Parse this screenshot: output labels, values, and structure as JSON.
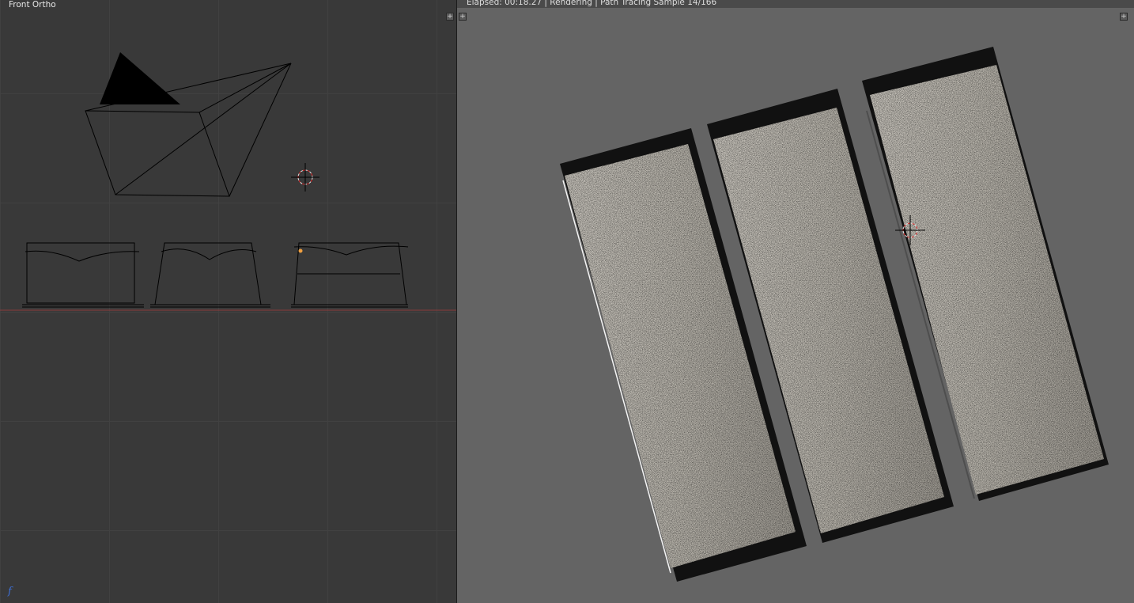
{
  "left_view": {
    "label": "Front Ortho",
    "axis_icon": "f",
    "colors": {
      "background": "#393939",
      "grid": "#414141",
      "wire": "#000000",
      "x_axis": "#8a3a3a",
      "selected": "#f0a040"
    }
  },
  "right_view": {
    "status": "Elapsed: 00:18.27 | Rendering | Path Tracing Sample 14/166",
    "colors": {
      "background": "#646464",
      "panel_fill": "#b5b1a8",
      "panel_edge": "#111111"
    }
  },
  "buttons": {
    "split_icon": "+"
  }
}
